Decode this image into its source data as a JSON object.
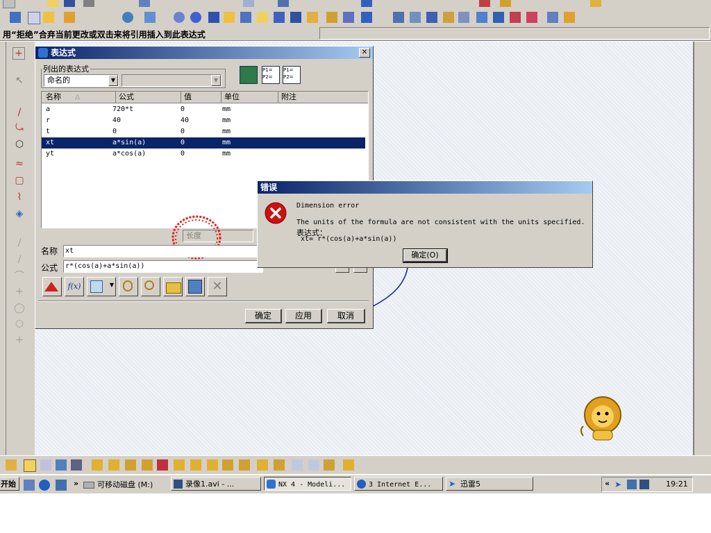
{
  "status_hint": "用“拒绝”合弃当前更改或双击来将引用插入到此表达式",
  "expression_dialog": {
    "title": "表达式",
    "list_group_label": "列出的表达式",
    "filter_value": "命名的",
    "columns": [
      "名称",
      "公式",
      "值",
      "单位",
      "附注"
    ],
    "rows": [
      {
        "name": "a",
        "formula": "720*t",
        "value": "0",
        "unit": "mm",
        "note": ""
      },
      {
        "name": "r",
        "formula": "40",
        "value": "40",
        "unit": "mm",
        "note": ""
      },
      {
        "name": "t",
        "formula": "0",
        "value": "0",
        "unit": "mm",
        "note": ""
      },
      {
        "name": "xt",
        "formula": "a*sin(a)",
        "value": "0",
        "unit": "mm",
        "note": ""
      },
      {
        "name": "yt",
        "formula": "a*cos(a)",
        "value": "0",
        "unit": "mm",
        "note": ""
      }
    ],
    "selected_row": 3,
    "unit_type_value": "长度",
    "name_label": "名称",
    "name_value": "xt",
    "formula_label": "公式",
    "formula_value": "r*(cos(a)+a*sin(a))",
    "ok_label": "确定",
    "apply_label": "应用",
    "cancel_label": "取消",
    "fx_label": "f(x)"
  },
  "error_dialog": {
    "title": "错误",
    "heading": "Dimension error",
    "message": "The units of the formula are not consistent with the units specified.",
    "expr_label": "表达式：",
    "expr_value": "xt= r*(cos(a)+a*sin(a))",
    "ok_label": "确定(O)"
  },
  "taskbar": {
    "start_label": "开始",
    "quick_launch_chevron": "»",
    "drive_label": "可移动磁盘 (M:)",
    "tasks": [
      {
        "label": "录像1.avi - ..."
      },
      {
        "label": "NX 4 - Modeli..."
      },
      {
        "label": "3 Internet E..."
      },
      {
        "label": "迅雷5"
      }
    ],
    "tray_chevron": "«",
    "clock": "19:21"
  },
  "colors": {
    "titlebar_dark": "#0a246a",
    "titlebar_light": "#a6caf0",
    "selection": "#0a246a",
    "error_icon": "#cc1111",
    "face": "#d4d0c8"
  }
}
